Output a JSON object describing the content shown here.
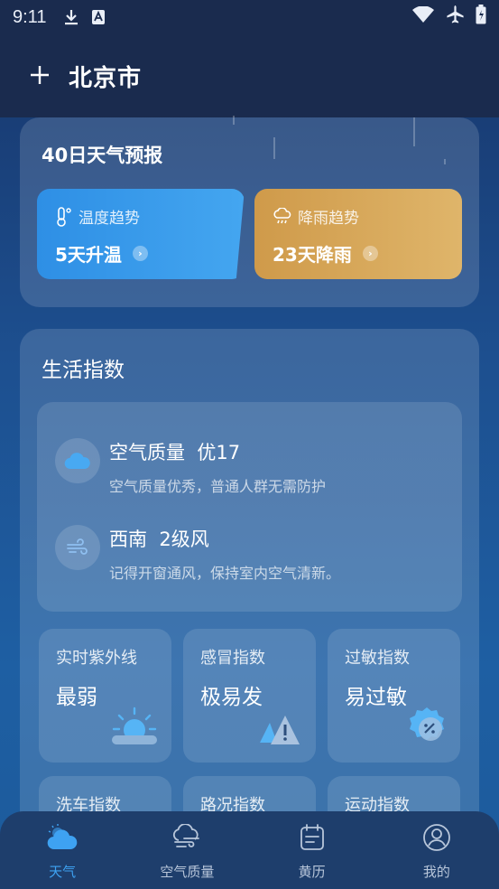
{
  "status_bar": {
    "time": "9:11"
  },
  "header": {
    "add_icon": "plus-icon",
    "city": "北京市"
  },
  "forecast40": {
    "title": "40日天气预报",
    "temp_trend": {
      "label": "温度趋势",
      "value": "5天升温",
      "color": "#2e8fe5"
    },
    "rain_trend": {
      "label": "降雨趋势",
      "value": "23天降雨",
      "color": "#d4a256"
    }
  },
  "life_index": {
    "title": "生活指数",
    "air": {
      "headline": "空气质量  优17",
      "desc": "空气质量优秀，普通人群无需防护"
    },
    "wind": {
      "headline": "西南  2级风",
      "desc": "记得开窗通风，保持室内空气清新。"
    },
    "items": [
      {
        "label": "实时紫外线",
        "value": "最弱"
      },
      {
        "label": "感冒指数",
        "value": "极易发"
      },
      {
        "label": "过敏指数",
        "value": "易过敏"
      },
      {
        "label": "洗车指数",
        "value": ""
      },
      {
        "label": "路况指数",
        "value": ""
      },
      {
        "label": "运动指数",
        "value": ""
      }
    ]
  },
  "bottom_nav": {
    "tabs": [
      {
        "label": "天气",
        "icon": "cloud-sun-icon",
        "active": true
      },
      {
        "label": "空气质量",
        "icon": "air-quality-icon",
        "active": false
      },
      {
        "label": "黄历",
        "icon": "calendar-icon",
        "active": false
      },
      {
        "label": "我的",
        "icon": "profile-icon",
        "active": false
      }
    ],
    "active_color": "#3ea2f2"
  }
}
